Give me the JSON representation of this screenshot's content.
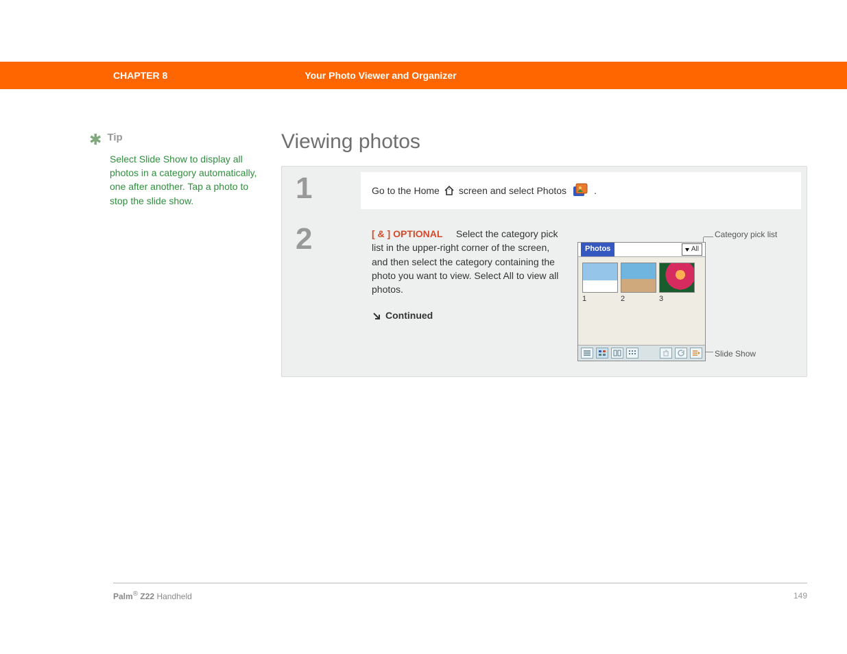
{
  "header": {
    "chapter_label": "CHAPTER 8",
    "chapter_title": "Your Photo Viewer and Organizer"
  },
  "sidebar": {
    "tip_label": "Tip",
    "tip_body": "Select Slide Show to display all photos in a category automatically, one after another. Tap a photo to stop the slide show."
  },
  "main": {
    "title": "Viewing photos",
    "step1": {
      "num": "1",
      "text_pre": "Go to the Home",
      "text_post": "screen and select Photos",
      "period": "."
    },
    "step2": {
      "num": "2",
      "optional_prefix": "[ & ]",
      "optional_label": "OPTIONAL",
      "body": "Select the category pick list in the upper-right corner of the screen, and then select the category containing the photo you want to view. Select All to view all photos.",
      "continued": "Continued"
    },
    "callouts": {
      "category": "Category pick list",
      "slideshow": "Slide Show"
    },
    "screenshot": {
      "app_title": "Photos",
      "picklist_value": "All",
      "thumbs": [
        "1",
        "2",
        "3"
      ]
    }
  },
  "footer": {
    "product_brand": "Palm",
    "product_reg": "®",
    "product_model": "Z22",
    "product_type": "Handheld",
    "page": "149"
  }
}
